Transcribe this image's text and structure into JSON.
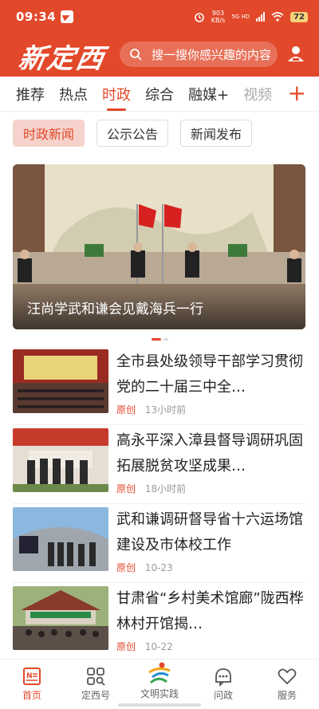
{
  "status": {
    "time": "09:34",
    "net_speed": "903",
    "net_unit": "KB/s",
    "net_type": "5G HD",
    "battery": "72"
  },
  "header": {
    "logo": "新定西",
    "search_placeholder": "搜一搜你感兴趣的内容"
  },
  "tabs": [
    {
      "label": "推荐"
    },
    {
      "label": "热点"
    },
    {
      "label": "时政"
    },
    {
      "label": "综合"
    },
    {
      "label": "融媒+"
    },
    {
      "label": "视频"
    }
  ],
  "tabs_plus": "+",
  "subtabs": [
    {
      "label": "时政新闻"
    },
    {
      "label": "公示公告"
    },
    {
      "label": "新闻发布"
    }
  ],
  "banner": {
    "caption": "汪尚学武和谦会见戴海兵一行"
  },
  "news": [
    {
      "title": "全市县处级领导干部学习贯彻党的二十届三中全…",
      "tag": "原创",
      "time": "13小时前"
    },
    {
      "title": "高永平深入漳县督导调研巩固拓展脱贫攻坚成果…",
      "tag": "原创",
      "time": "18小时前"
    },
    {
      "title": "武和谦调研督导省十六运场馆建设及市体校工作",
      "tag": "原创",
      "time": "10-23"
    },
    {
      "title": "甘肃省“乡村美术馆廊”陇西桦林村开馆揭…",
      "tag": "原创",
      "time": "10-22"
    }
  ],
  "bottom_nav": [
    {
      "label": "首页",
      "icon": "news-icon"
    },
    {
      "label": "定西号",
      "icon": "grid-search-icon"
    },
    {
      "label": "文明实践",
      "icon": "civilization-logo-icon"
    },
    {
      "label": "问政",
      "icon": "speech-icon"
    },
    {
      "label": "服务",
      "icon": "heart-icon"
    }
  ],
  "colors": {
    "brand": "#e2482a",
    "subtab_active_bg": "#f5d3cc"
  }
}
